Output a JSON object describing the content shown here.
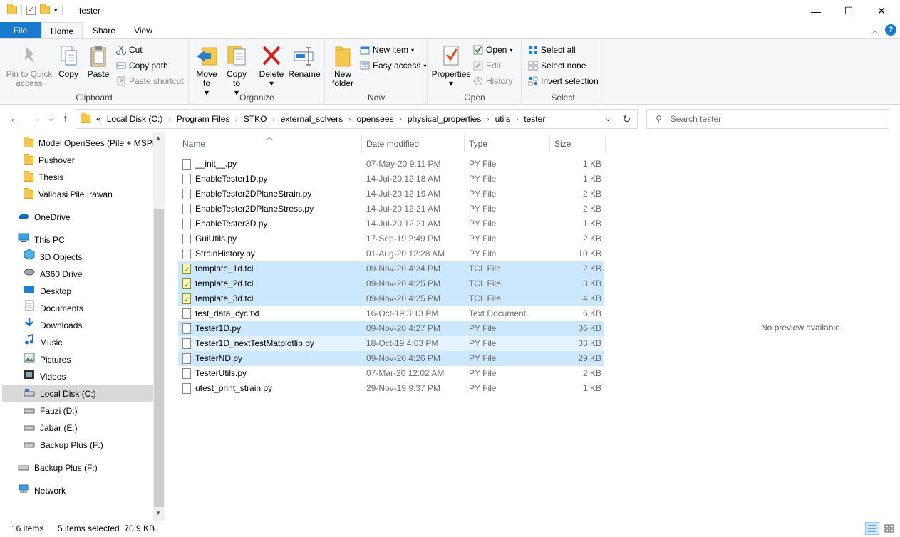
{
  "window": {
    "title": "tester",
    "qat_arrow": "▾",
    "controls": {
      "minimize": "—",
      "maximize": "☐",
      "close": "✕"
    }
  },
  "ribbon_tabs": [
    "File",
    "Home",
    "Share",
    "View"
  ],
  "ribbon_help": "?",
  "ribbon_collapse": "︿",
  "clipboard": {
    "group": "Clipboard",
    "pin": "Pin to Quick access",
    "copy": "Copy",
    "paste": "Paste",
    "cut": "Cut",
    "copy_path": "Copy path",
    "paste_shortcut": "Paste shortcut"
  },
  "organize": {
    "group": "Organize",
    "move_to": "Move to",
    "copy_to": "Copy to",
    "delete": "Delete",
    "rename": "Rename"
  },
  "new": {
    "group": "New",
    "new_folder": "New folder",
    "new_item": "New item",
    "easy_access": "Easy access"
  },
  "open": {
    "group": "Open",
    "properties": "Properties",
    "open": "Open",
    "edit": "Edit",
    "history": "History"
  },
  "select": {
    "group": "Select",
    "select_all": "Select all",
    "select_none": "Select none",
    "invert": "Invert selection"
  },
  "address": {
    "overflow": "«",
    "crumbs": [
      "Local Disk (C:)",
      "Program Files",
      "STKO",
      "external_solvers",
      "opensees",
      "physical_properties",
      "utils",
      "tester"
    ],
    "separator": "›"
  },
  "search": {
    "placeholder": "Search tester"
  },
  "nav_glyphs": {
    "back": "←",
    "forward": "→",
    "recent": "⌄",
    "up": "↑",
    "refresh": "↻",
    "search": "⚲",
    "dropdown": "⌄",
    "sort": "︿",
    "scroll_up": "▲",
    "scroll_down": "▼"
  },
  "nav_pane": [
    {
      "label": "Model OpenSees (Pile + MSPD",
      "icon": "folder-icon"
    },
    {
      "label": "Pushover",
      "icon": "folder-icon"
    },
    {
      "label": "Thesis",
      "icon": "folder-icon"
    },
    {
      "label": "Validasi Pile Irawan",
      "icon": "folder-icon"
    },
    {
      "label": "OneDrive",
      "icon": "cloud-icon"
    },
    {
      "label": "This PC",
      "icon": "pc-icon"
    },
    {
      "label": "3D Objects",
      "icon": "cube-icon"
    },
    {
      "label": "A360 Drive",
      "icon": "drive-icon"
    },
    {
      "label": "Desktop",
      "icon": "desktop-icon"
    },
    {
      "label": "Documents",
      "icon": "documents-icon"
    },
    {
      "label": "Downloads",
      "icon": "download-icon"
    },
    {
      "label": "Music",
      "icon": "music-icon"
    },
    {
      "label": "Pictures",
      "icon": "pictures-icon"
    },
    {
      "label": "Videos",
      "icon": "videos-icon"
    },
    {
      "label": "Local Disk (C:)",
      "icon": "disk-icon"
    },
    {
      "label": "Fauzi (D:)",
      "icon": "disk-icon"
    },
    {
      "label": "Jabar (E:)",
      "icon": "disk-icon"
    },
    {
      "label": "Backup Plus (F:)",
      "icon": "disk-icon"
    },
    {
      "label": "Backup Plus (F:)",
      "icon": "disk-icon"
    },
    {
      "label": "Network",
      "icon": "network-icon"
    }
  ],
  "columns": [
    "Name",
    "Date modified",
    "Type",
    "Size"
  ],
  "files": [
    {
      "name": "__init__.py",
      "date": "07-May-20 9:11 PM",
      "type": "PY File",
      "size": "1 KB"
    },
    {
      "name": "EnableTester1D.py",
      "date": "14-Jul-20 12:18 AM",
      "type": "PY File",
      "size": "1 KB"
    },
    {
      "name": "EnableTester2DPlaneStrain.py",
      "date": "14-Jul-20 12:19 AM",
      "type": "PY File",
      "size": "2 KB"
    },
    {
      "name": "EnableTester2DPlaneStress.py",
      "date": "14-Jul-20 12:21 AM",
      "type": "PY File",
      "size": "2 KB"
    },
    {
      "name": "EnableTester3D.py",
      "date": "14-Jul-20 12:21 AM",
      "type": "PY File",
      "size": "1 KB"
    },
    {
      "name": "GuiUtils.py",
      "date": "17-Sep-19 2:49 PM",
      "type": "PY File",
      "size": "2 KB"
    },
    {
      "name": "StrainHistory.py",
      "date": "01-Aug-20 12:28 AM",
      "type": "PY File",
      "size": "10 KB"
    },
    {
      "name": "template_1d.tcl",
      "date": "09-Nov-20 4:24 PM",
      "type": "TCL File",
      "size": "2 KB"
    },
    {
      "name": "template_2d.tcl",
      "date": "09-Nov-20 4:25 PM",
      "type": "TCL File",
      "size": "3 KB"
    },
    {
      "name": "template_3d.tcl",
      "date": "09-Nov-20 4:25 PM",
      "type": "TCL File",
      "size": "4 KB"
    },
    {
      "name": "test_data_cyc.txt",
      "date": "16-Oct-19 3:13 PM",
      "type": "Text Document",
      "size": "6 KB"
    },
    {
      "name": "Tester1D.py",
      "date": "09-Nov-20 4:27 PM",
      "type": "PY File",
      "size": "36 KB"
    },
    {
      "name": "Tester1D_nextTestMatplotlib.py",
      "date": "18-Oct-19 4:03 PM",
      "type": "PY File",
      "size": "33 KB"
    },
    {
      "name": "TesterND.py",
      "date": "09-Nov-20 4:26 PM",
      "type": "PY File",
      "size": "29 KB"
    },
    {
      "name": "TesterUtils.py",
      "date": "07-Mar-20 12:02 AM",
      "type": "PY File",
      "size": "2 KB"
    },
    {
      "name": "utest_print_strain.py",
      "date": "29-Nov-19 9:37 PM",
      "type": "PY File",
      "size": "1 KB"
    }
  ],
  "preview": "No preview available.",
  "status": {
    "count": "16 items",
    "selected": "5 items selected  70.9 KB"
  },
  "colors": {
    "accent": "#1979ca",
    "selection": "#cce8ff",
    "hover": "#e5f3ff"
  }
}
